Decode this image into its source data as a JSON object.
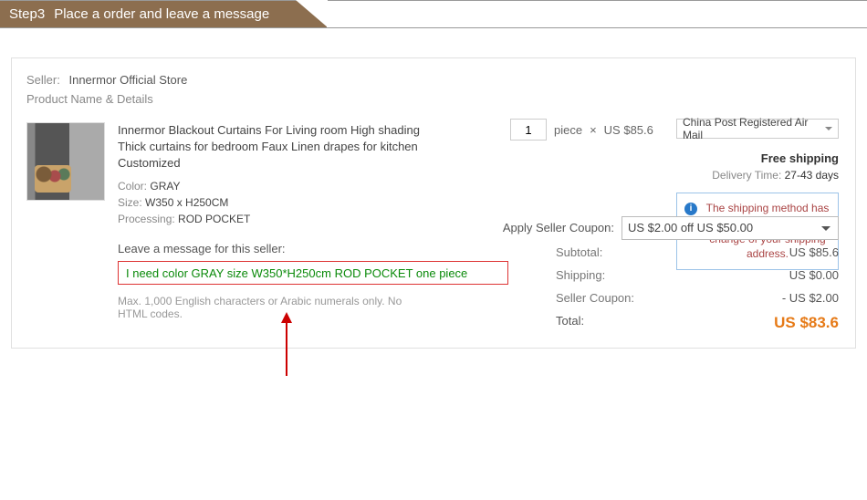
{
  "step": {
    "number": "Step3",
    "title": "Place a order and leave a message"
  },
  "seller": {
    "label": "Seller:",
    "name": "Innermor Official Store"
  },
  "productNameLabel": "Product Name & Details",
  "product": {
    "title": "Innermor Blackout Curtains For Living room High shading Thick curtains for bedroom Faux Linen drapes for kitchen Customized",
    "colorLabel": "Color:",
    "color": "GRAY",
    "sizeLabel": "Size:",
    "size": "W350 x H250CM",
    "processingLabel": "Processing:",
    "processing": "ROD POCKET"
  },
  "message": {
    "label": "Leave a message for this seller:",
    "value": "I need color GRAY size W350*H250cm ROD POCKET one piece",
    "hint": "Max. 1,000 English characters or Arabic numerals only. No HTML codes."
  },
  "quantity": {
    "value": "1",
    "unit": "piece",
    "times": "×",
    "price": "US $85.6"
  },
  "shipping": {
    "method": "China Post Registered Air Mail",
    "free": "Free shipping",
    "deliveryLabel": "Delivery Time:",
    "deliveryDays": "27-43 days"
  },
  "notice": "The shipping method has been changed due to the change of your shipping address.",
  "coupon": {
    "label": "Apply Seller Coupon:",
    "selected": "US $2.00 off US $50.00"
  },
  "totals": {
    "subtotalLabel": "Subtotal:",
    "subtotal": "US $85.6",
    "shippingLabel": "Shipping:",
    "shipping": "US $0.00",
    "couponLabel": "Seller Coupon:",
    "coupon": "- US $2.00",
    "totalLabel": "Total:",
    "total": "US $83.6"
  }
}
